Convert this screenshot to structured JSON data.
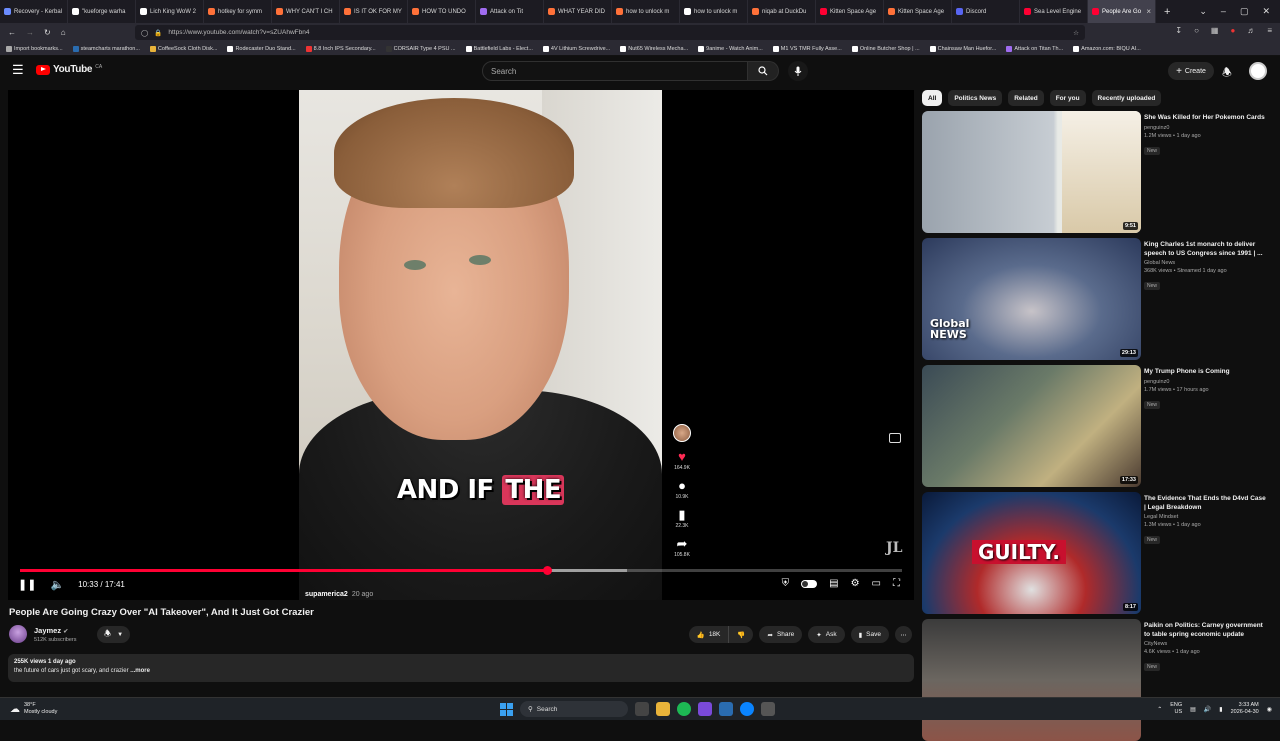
{
  "browser": {
    "tabs": [
      {
        "label": "Recovery - Kerbal",
        "color": "#6b8cff"
      },
      {
        "label": "\"kueforge warha",
        "color": "#ffffff"
      },
      {
        "label": "Lich King WoW 2",
        "color": "#ffffff"
      },
      {
        "label": "hotkey for symm",
        "color": "#ff7139"
      },
      {
        "label": "WHY CAN'T I CH",
        "color": "#ff7139"
      },
      {
        "label": "IS IT OK FOR MY",
        "color": "#ff7139"
      },
      {
        "label": "HOW TO UNDO",
        "color": "#ff7139"
      },
      {
        "label": "Attack on Tit",
        "color": "#a06cf0"
      },
      {
        "label": "WHAT YEAR DID",
        "color": "#ff7139"
      },
      {
        "label": "how to unlock m",
        "color": "#ff7139"
      },
      {
        "label": "how to unlock m",
        "color": "#ffffff"
      },
      {
        "label": "niqab at DuckDu",
        "color": "#ff7139"
      },
      {
        "label": "Kitten Space Age",
        "color": "#ff0033"
      },
      {
        "label": "Kitten Space Age",
        "color": "#ff7139"
      },
      {
        "label": "Discord",
        "color": "#5865f2"
      },
      {
        "label": "Sea Level Engine",
        "color": "#ff0033"
      },
      {
        "label": "People Are Go",
        "color": "#ff0033",
        "active": true,
        "sub": "PLAYING"
      }
    ],
    "url": "https://www.youtube.com/watch?v=sZUAhwFbn4",
    "bookmarks": [
      "Import bookmarks...",
      "steamcharts marathon...",
      "CoffeeSock Cloth Disk...",
      "Rodecaster Duo Stand...",
      "8.8 Inch IPS Secondary...",
      "CORSAIR Type 4 PSU ...",
      "Battlefield Labs - Elect...",
      "4V Lithium Screwdrive...",
      "Nut65 Wireless Mecha...",
      "9anime - Watch Anim...",
      "M1 VS TMR Fully Asse...",
      "Online Butcher Shop | ...",
      "Chainsaw Man Huefor...",
      "Attack on Titan Th...",
      "Amazon.com: BIQU AI..."
    ]
  },
  "yt_header": {
    "logo": "YouTube",
    "country": "CA",
    "search_placeholder": "Search",
    "create_label": "Create"
  },
  "player": {
    "caption_pre": "AND IF ",
    "caption_hl": "THE",
    "tiktok_user": "supamerica2",
    "tiktok_age": "20 ago",
    "counts": {
      "likes": "164.9K",
      "comments": "10.9K",
      "saves": "22.3K",
      "shares": "105.8K"
    },
    "watermark": "JL",
    "time": "10:33 / 17:41",
    "progress_played_percent": 59.7,
    "progress_loaded_percent": 68.8
  },
  "video": {
    "title": "People Are Going Crazy Over \"AI Takeover\", And It Just Got Crazier",
    "channel": "Jaymez",
    "subscribers": "512K subscribers",
    "likes": "18K",
    "share_label": "Share",
    "ask_label": "Ask",
    "save_label": "Save",
    "views_date": "255K views  1 day ago",
    "description": "the future of cars just got scary, and crazier",
    "more_label": "...more"
  },
  "sidebar": {
    "chips": [
      "All",
      "Politics News",
      "Related",
      "For you",
      "Recently uploaded"
    ],
    "recommendations": [
      {
        "title": "She Was Killed for Her Pokemon Cards",
        "channel": "penguinz0",
        "meta": "1.2M views • 1 day ago",
        "badge": "New",
        "duration": "9:51"
      },
      {
        "title": "King Charles 1st monarch to deliver speech to US Congress since 1991 | ...",
        "channel": "Global News",
        "meta": "368K views • Streamed 1 day ago",
        "badge": "New",
        "duration": "29:13",
        "overlay": "Global NEWS"
      },
      {
        "title": "My Trump Phone is Coming",
        "channel": "penguinz0",
        "meta": "1.7M views • 17 hours ago",
        "badge": "New",
        "duration": "17:33"
      },
      {
        "title": "The Evidence That Ends the D4vd Case | Legal Breakdown",
        "channel": "Legal Mindset",
        "meta": "1.3M views • 1 day ago",
        "badge": "New",
        "duration": "8:17",
        "overlay": "GUILTY."
      },
      {
        "title": "Paikin on Politics: Carney government to table spring economic update",
        "channel": "CityNews",
        "meta": "4.6K views • 1 day ago",
        "badge": "New",
        "duration": ""
      }
    ]
  },
  "taskbar": {
    "temp": "38°F",
    "weather": "Mostly cloudy",
    "search": "Search",
    "lang": "ENG",
    "region": "US",
    "time": "3:33 AM",
    "date": "2026-04-30"
  }
}
